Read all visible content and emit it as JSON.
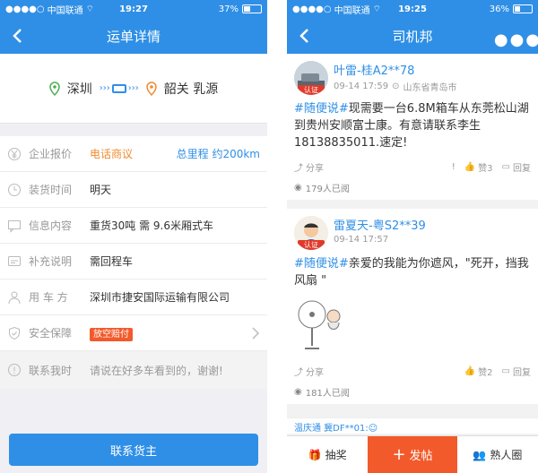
{
  "colors": {
    "primary": "#2f8fe6",
    "accent": "#f25a2b",
    "orange_text": "#f08a2e"
  },
  "left": {
    "status": {
      "carrier": "中国联通",
      "time": "19:27",
      "battery": "37%",
      "battery_level": 0.37
    },
    "title": "运单详情",
    "route": {
      "from": "深圳",
      "to": "韶关 乳源"
    },
    "rows": [
      {
        "icon": "yen-icon",
        "label": "企业报价",
        "value": "电话商议",
        "extra": "总里程 约200km"
      },
      {
        "icon": "clock-icon",
        "label": "装货时间",
        "value": "明天"
      },
      {
        "icon": "message-icon",
        "label": "信息内容",
        "value": "重货30吨 需 9.6米厢式车"
      },
      {
        "icon": "note-icon",
        "label": "补充说明",
        "value": "需回程车"
      },
      {
        "icon": "user-icon",
        "label": "用 车 方",
        "value": "深圳市捷安国际运输有限公司"
      },
      {
        "icon": "shield-icon",
        "label": "安全保障",
        "badge": "放空赔付"
      }
    ],
    "contact_row": {
      "icon": "info-icon",
      "label": "联系我时",
      "value": "请说在好多车看到的，谢谢!"
    },
    "contact_button": "联系货主"
  },
  "right": {
    "status": {
      "carrier": "中国联通",
      "time": "19:25",
      "battery": "36%",
      "battery_level": 0.36
    },
    "title": "司机邦",
    "posts": [
      {
        "user": "叶雷-桂A2**78",
        "badge": "认证",
        "time": "09-14 17:59",
        "location": "山东省青岛市",
        "hashtag": "#随便说#",
        "text": "现需要一台6.8M箱车从东莞松山湖到贵州安顺富士康。有意请联系李生18138835011.速定!",
        "share": "分享",
        "likes": "赞3",
        "reply": "回复",
        "views": "179人已阅"
      },
      {
        "user": "雷夏天-粤S2**39",
        "badge": "认证",
        "time": "09-14 17:57",
        "hashtag": "#随便说#",
        "text": "亲爱的我能为你遮风，\"死开，挡我风扇 \"",
        "share": "分享",
        "likes": "赞2",
        "reply": "回复",
        "views": "181人已阅"
      }
    ],
    "ticker": "温庆通 冀DF**01:",
    "tabs": {
      "lottery": "抽奖",
      "post": "发帖",
      "circle": "熟人圈"
    }
  }
}
